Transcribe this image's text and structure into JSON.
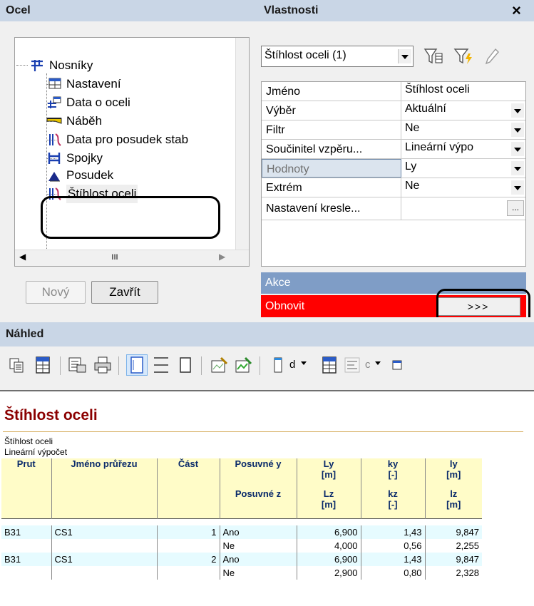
{
  "steel_panel": {
    "title": "Ocel",
    "tree": [
      {
        "label": "Nosníky",
        "icon": "beam-structure-icon"
      },
      {
        "label": "Nastavení",
        "icon": "settings-table-icon"
      },
      {
        "label": "Data o oceli",
        "icon": "steel-data-icon"
      },
      {
        "label": "Náběh",
        "icon": "haunch-icon"
      },
      {
        "label": "Data pro posudek stab",
        "icon": "stability-data-icon"
      },
      {
        "label": "Spojky",
        "icon": "connectors-icon"
      },
      {
        "label": "Posudek",
        "icon": "check-icon"
      },
      {
        "label": "Štíhlost oceli",
        "icon": "slenderness-icon"
      }
    ],
    "scroll_thumb_label": "III",
    "new_button": "Nový",
    "close_button": "Zavřít"
  },
  "properties_panel": {
    "title": "Vlastnosti",
    "close_glyph": "×",
    "selector_value": "Štíhlost oceli (1)",
    "rows": [
      {
        "name": "Jméno",
        "value": "Štíhlost oceli",
        "dropdown": false
      },
      {
        "name": "Výběr",
        "value": "Aktuální",
        "dropdown": true
      },
      {
        "name": "Filtr",
        "value": "Ne",
        "dropdown": true
      },
      {
        "name": "Součinitel vzpěru...",
        "value": "Lineární výpo",
        "dropdown": true
      },
      {
        "name": "Hodnoty",
        "value": "Ly",
        "dropdown": true
      },
      {
        "name": "Extrém",
        "value": "Ne",
        "dropdown": true
      },
      {
        "name": "Nastavení kresle...",
        "value": "",
        "ellipsis": "..."
      }
    ],
    "actions_header": "Akce",
    "refresh_label": "Obnovit",
    "refresh_button": ">>>"
  },
  "preview_panel": {
    "title": "Náhled",
    "combo1_value": "d",
    "combo2_value": "c",
    "report": {
      "title": "Štíhlost oceli",
      "subtitle": "Štíhlost oceli",
      "method": "Lineární výpočet",
      "headers": {
        "prut": "Prut",
        "jmeno": "Jméno průřezu",
        "cast": "Část",
        "pos_y": "Posuvné y",
        "pos_z": "Posuvné z",
        "ly": "Ly",
        "ly_unit": "[m]",
        "lz": "Lz",
        "lz_unit": "[m]",
        "ky": "ky",
        "ky_unit": "[-]",
        "kz": "kz",
        "kz_unit": "[-]",
        "iy": "ly",
        "iy_unit": "[m]",
        "iz": "lz",
        "iz_unit": "[m]"
      },
      "rows": [
        {
          "prut": "B31",
          "jmeno": "CS1",
          "cast": "1",
          "posuvne": "Ano",
          "L": "6,900",
          "k": "1,43",
          "l": "9,847"
        },
        {
          "prut": "",
          "jmeno": "",
          "cast": "",
          "posuvne": "Ne",
          "L": "4,000",
          "k": "0,56",
          "l": "2,255"
        },
        {
          "prut": "B31",
          "jmeno": "CS1",
          "cast": "2",
          "posuvne": "Ano",
          "L": "6,900",
          "k": "1,43",
          "l": "9,847"
        },
        {
          "prut": "",
          "jmeno": "",
          "cast": "",
          "posuvne": "Ne",
          "L": "2,900",
          "k": "0,80",
          "l": "2,328"
        }
      ]
    }
  },
  "colors": {
    "title_bar": "#c9d6e6",
    "refresh_red": "#ff0000",
    "actions_blue": "#7f9dc6",
    "report_title": "#8b0000",
    "header_fill": "#fffcc8",
    "row_fill": "#e6fbff"
  }
}
